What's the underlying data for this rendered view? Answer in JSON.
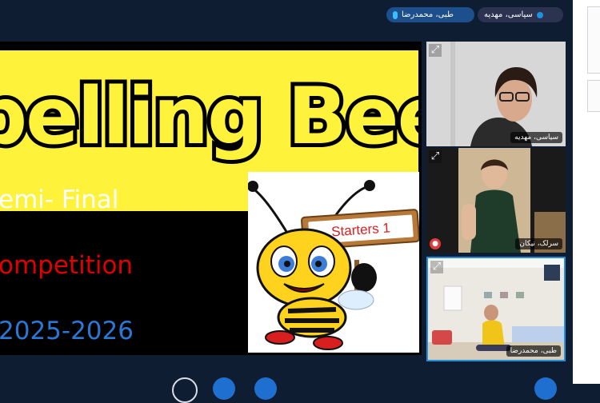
{
  "top_bar": {
    "active_speaker": "طبی، محمدرضا",
    "presenter": "سیاسی، مهدیه"
  },
  "shared_screen": {
    "banner": "pelling Bee",
    "line1": "emi- Final",
    "line2": "ompetition",
    "line3": "2025-2026",
    "sign_text": "Starters 1"
  },
  "participants": [
    {
      "name": "سیاسی، مهدیه"
    },
    {
      "name": "سرلک، نیکان"
    },
    {
      "name": "طبی، محمدرضا"
    }
  ],
  "colors": {
    "background": "#0f1d33",
    "banner_yellow": "#fff23a",
    "competition_red": "#e00000",
    "year_blue": "#2a77d6",
    "active_border": "#1f8fe0"
  },
  "icons": {
    "expand": "expand-icon",
    "mic": "mic-icon",
    "status": "status-dot-icon"
  }
}
